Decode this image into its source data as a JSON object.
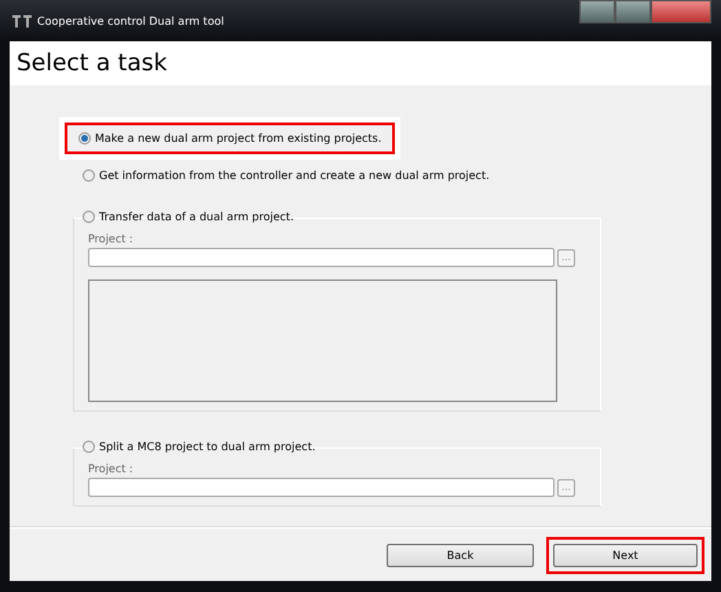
{
  "window": {
    "title": "Cooperative control Dual arm tool"
  },
  "header": {
    "title": "Select a task"
  },
  "options": [
    {
      "kind": "plain",
      "label": "Make a new dual arm project from existing projects.",
      "selected": true,
      "highlighted": true
    },
    {
      "kind": "plain",
      "label": "Get information from the controller and create a new dual arm project.",
      "selected": false,
      "highlighted": false
    },
    {
      "kind": "transfer",
      "label": "Transfer data of a dual arm project.",
      "selected": false,
      "highlighted": false,
      "project_label": "Project :",
      "browse": "..."
    },
    {
      "kind": "split",
      "label": "Split a MC8 project to dual arm project.",
      "selected": false,
      "highlighted": false,
      "project_label": "Project :",
      "browse": "..."
    }
  ],
  "buttons": [
    {
      "label": "Back",
      "highlighted": false
    },
    {
      "label": "Next",
      "highlighted": true
    }
  ]
}
